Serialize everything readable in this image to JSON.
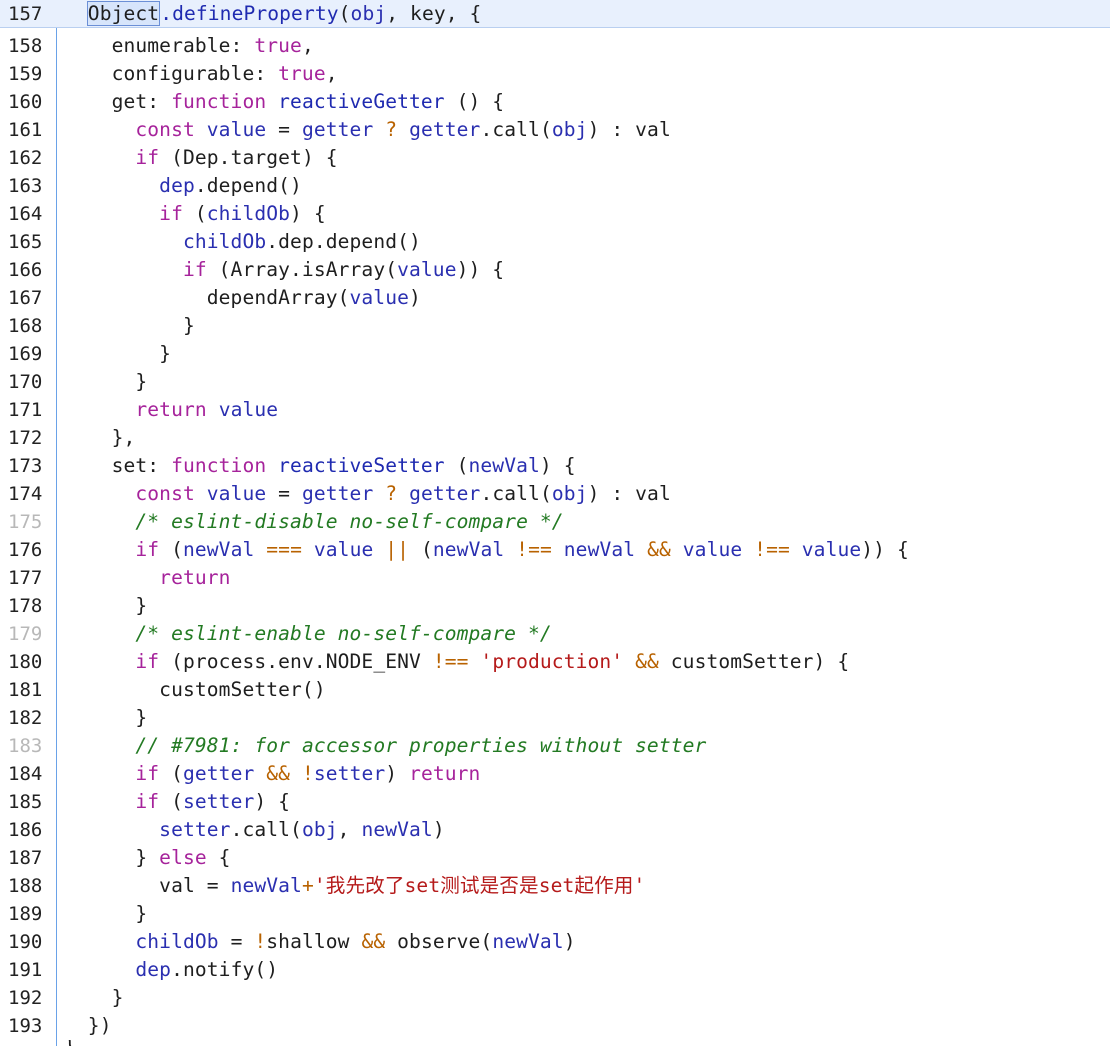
{
  "editor": {
    "lines": [
      {
        "num": "157",
        "dim": false,
        "tokens": [
          [
            "pl",
            "  "
          ],
          [
            "sel",
            "Object"
          ],
          [
            "fn",
            ".defineProperty"
          ],
          [
            "pl",
            "("
          ],
          [
            "var",
            "obj"
          ],
          [
            "pl",
            ", key, {"
          ]
        ]
      },
      {
        "num": "158",
        "dim": false,
        "tokens": [
          [
            "pl",
            "    enumerable: "
          ],
          [
            "kw",
            "true"
          ],
          [
            "pl",
            ","
          ]
        ]
      },
      {
        "num": "159",
        "dim": false,
        "tokens": [
          [
            "pl",
            "    configurable: "
          ],
          [
            "kw",
            "true"
          ],
          [
            "pl",
            ","
          ]
        ]
      },
      {
        "num": "160",
        "dim": false,
        "tokens": [
          [
            "pl",
            "    get: "
          ],
          [
            "kw",
            "function"
          ],
          [
            "pl",
            " "
          ],
          [
            "fn",
            "reactiveGetter"
          ],
          [
            "pl",
            " () {"
          ]
        ]
      },
      {
        "num": "161",
        "dim": false,
        "tokens": [
          [
            "pl",
            "      "
          ],
          [
            "kw",
            "const"
          ],
          [
            "pl",
            " "
          ],
          [
            "var",
            "value"
          ],
          [
            "pl",
            " = "
          ],
          [
            "var",
            "getter"
          ],
          [
            "pl",
            " "
          ],
          [
            "op",
            "?"
          ],
          [
            "pl",
            " "
          ],
          [
            "var",
            "getter"
          ],
          [
            "pl",
            ".call("
          ],
          [
            "var",
            "obj"
          ],
          [
            "pl",
            ") : val"
          ]
        ]
      },
      {
        "num": "162",
        "dim": false,
        "tokens": [
          [
            "pl",
            "      "
          ],
          [
            "kw",
            "if"
          ],
          [
            "pl",
            " (Dep.target) {"
          ]
        ]
      },
      {
        "num": "163",
        "dim": false,
        "tokens": [
          [
            "pl",
            "        "
          ],
          [
            "var",
            "dep"
          ],
          [
            "pl",
            ".depend()"
          ]
        ]
      },
      {
        "num": "164",
        "dim": false,
        "tokens": [
          [
            "pl",
            "        "
          ],
          [
            "kw",
            "if"
          ],
          [
            "pl",
            " ("
          ],
          [
            "var",
            "childOb"
          ],
          [
            "pl",
            ") {"
          ]
        ]
      },
      {
        "num": "165",
        "dim": false,
        "tokens": [
          [
            "pl",
            "          "
          ],
          [
            "var",
            "childOb"
          ],
          [
            "pl",
            ".dep.depend()"
          ]
        ]
      },
      {
        "num": "166",
        "dim": false,
        "tokens": [
          [
            "pl",
            "          "
          ],
          [
            "kw",
            "if"
          ],
          [
            "pl",
            " (Array.isArray("
          ],
          [
            "var",
            "value"
          ],
          [
            "pl",
            ")) {"
          ]
        ]
      },
      {
        "num": "167",
        "dim": false,
        "tokens": [
          [
            "pl",
            "            dependArray("
          ],
          [
            "var",
            "value"
          ],
          [
            "pl",
            ")"
          ]
        ]
      },
      {
        "num": "168",
        "dim": false,
        "tokens": [
          [
            "pl",
            "          }"
          ]
        ]
      },
      {
        "num": "169",
        "dim": false,
        "tokens": [
          [
            "pl",
            "        }"
          ]
        ]
      },
      {
        "num": "170",
        "dim": false,
        "tokens": [
          [
            "pl",
            "      }"
          ]
        ]
      },
      {
        "num": "171",
        "dim": false,
        "tokens": [
          [
            "pl",
            "      "
          ],
          [
            "kw",
            "return"
          ],
          [
            "pl",
            " "
          ],
          [
            "var",
            "value"
          ]
        ]
      },
      {
        "num": "172",
        "dim": false,
        "tokens": [
          [
            "pl",
            "    },"
          ]
        ]
      },
      {
        "num": "173",
        "dim": false,
        "tokens": [
          [
            "pl",
            "    set: "
          ],
          [
            "kw",
            "function"
          ],
          [
            "pl",
            " "
          ],
          [
            "fn",
            "reactiveSetter"
          ],
          [
            "pl",
            " ("
          ],
          [
            "var",
            "newVal"
          ],
          [
            "pl",
            ") {"
          ]
        ]
      },
      {
        "num": "174",
        "dim": false,
        "tokens": [
          [
            "pl",
            "      "
          ],
          [
            "kw",
            "const"
          ],
          [
            "pl",
            " "
          ],
          [
            "var",
            "value"
          ],
          [
            "pl",
            " = "
          ],
          [
            "var",
            "getter"
          ],
          [
            "pl",
            " "
          ],
          [
            "op",
            "?"
          ],
          [
            "pl",
            " "
          ],
          [
            "var",
            "getter"
          ],
          [
            "pl",
            ".call("
          ],
          [
            "var",
            "obj"
          ],
          [
            "pl",
            ") : val"
          ]
        ]
      },
      {
        "num": "175",
        "dim": true,
        "tokens": [
          [
            "pl",
            "      "
          ],
          [
            "cm",
            "/* eslint-disable no-self-compare */"
          ]
        ]
      },
      {
        "num": "176",
        "dim": false,
        "tokens": [
          [
            "pl",
            "      "
          ],
          [
            "kw",
            "if"
          ],
          [
            "pl",
            " ("
          ],
          [
            "var",
            "newVal"
          ],
          [
            "pl",
            " "
          ],
          [
            "op",
            "==="
          ],
          [
            "pl",
            " "
          ],
          [
            "var",
            "value"
          ],
          [
            "pl",
            " "
          ],
          [
            "op",
            "||"
          ],
          [
            "pl",
            " ("
          ],
          [
            "var",
            "newVal"
          ],
          [
            "pl",
            " "
          ],
          [
            "op",
            "!=="
          ],
          [
            "pl",
            " "
          ],
          [
            "var",
            "newVal"
          ],
          [
            "pl",
            " "
          ],
          [
            "op",
            "&&"
          ],
          [
            "pl",
            " "
          ],
          [
            "var",
            "value"
          ],
          [
            "pl",
            " "
          ],
          [
            "op",
            "!=="
          ],
          [
            "pl",
            " "
          ],
          [
            "var",
            "value"
          ],
          [
            "pl",
            ")) {"
          ]
        ]
      },
      {
        "num": "177",
        "dim": false,
        "tokens": [
          [
            "pl",
            "        "
          ],
          [
            "kw",
            "return"
          ]
        ]
      },
      {
        "num": "178",
        "dim": false,
        "tokens": [
          [
            "pl",
            "      }"
          ]
        ]
      },
      {
        "num": "179",
        "dim": true,
        "tokens": [
          [
            "pl",
            "      "
          ],
          [
            "cm",
            "/* eslint-enable no-self-compare */"
          ]
        ]
      },
      {
        "num": "180",
        "dim": false,
        "tokens": [
          [
            "pl",
            "      "
          ],
          [
            "kw",
            "if"
          ],
          [
            "pl",
            " (process.env.NODE_ENV "
          ],
          [
            "op",
            "!=="
          ],
          [
            "pl",
            " "
          ],
          [
            "str",
            "'production'"
          ],
          [
            "pl",
            " "
          ],
          [
            "op",
            "&&"
          ],
          [
            "pl",
            " customSetter) {"
          ]
        ]
      },
      {
        "num": "181",
        "dim": false,
        "tokens": [
          [
            "pl",
            "        customSetter()"
          ]
        ]
      },
      {
        "num": "182",
        "dim": false,
        "tokens": [
          [
            "pl",
            "      }"
          ]
        ]
      },
      {
        "num": "183",
        "dim": true,
        "tokens": [
          [
            "pl",
            "      "
          ],
          [
            "cm",
            "// #7981: for accessor properties without setter"
          ]
        ]
      },
      {
        "num": "184",
        "dim": false,
        "tokens": [
          [
            "pl",
            "      "
          ],
          [
            "kw",
            "if"
          ],
          [
            "pl",
            " ("
          ],
          [
            "var",
            "getter"
          ],
          [
            "pl",
            " "
          ],
          [
            "op",
            "&&"
          ],
          [
            "pl",
            " "
          ],
          [
            "op",
            "!"
          ],
          [
            "var",
            "setter"
          ],
          [
            "pl",
            ") "
          ],
          [
            "kw",
            "return"
          ]
        ]
      },
      {
        "num": "185",
        "dim": false,
        "tokens": [
          [
            "pl",
            "      "
          ],
          [
            "kw",
            "if"
          ],
          [
            "pl",
            " ("
          ],
          [
            "var",
            "setter"
          ],
          [
            "pl",
            ") {"
          ]
        ]
      },
      {
        "num": "186",
        "dim": false,
        "tokens": [
          [
            "pl",
            "        "
          ],
          [
            "var",
            "setter"
          ],
          [
            "pl",
            ".call("
          ],
          [
            "var",
            "obj"
          ],
          [
            "pl",
            ", "
          ],
          [
            "var",
            "newVal"
          ],
          [
            "pl",
            ")"
          ]
        ]
      },
      {
        "num": "187",
        "dim": false,
        "tokens": [
          [
            "pl",
            "      } "
          ],
          [
            "kw",
            "else"
          ],
          [
            "pl",
            " {"
          ]
        ]
      },
      {
        "num": "188",
        "dim": false,
        "tokens": [
          [
            "pl",
            "        val "
          ],
          [
            "pl",
            "= "
          ],
          [
            "var",
            "newVal"
          ],
          [
            "op",
            "+"
          ],
          [
            "str",
            "'我先改了set测试是否是set起作用'"
          ]
        ]
      },
      {
        "num": "189",
        "dim": false,
        "tokens": [
          [
            "pl",
            "      }"
          ]
        ]
      },
      {
        "num": "190",
        "dim": false,
        "tokens": [
          [
            "pl",
            "      "
          ],
          [
            "var",
            "childOb"
          ],
          [
            "pl",
            " = "
          ],
          [
            "op",
            "!"
          ],
          [
            "pl",
            "shallow "
          ],
          [
            "op",
            "&&"
          ],
          [
            "pl",
            " observe("
          ],
          [
            "var",
            "newVal"
          ],
          [
            "pl",
            ")"
          ]
        ]
      },
      {
        "num": "191",
        "dim": false,
        "tokens": [
          [
            "pl",
            "      "
          ],
          [
            "var",
            "dep"
          ],
          [
            "pl",
            ".notify()"
          ]
        ]
      },
      {
        "num": "192",
        "dim": false,
        "tokens": [
          [
            "pl",
            "    }"
          ]
        ]
      },
      {
        "num": "193",
        "dim": false,
        "tokens": [
          [
            "pl",
            "  })"
          ]
        ]
      }
    ],
    "cut_text": "}"
  }
}
